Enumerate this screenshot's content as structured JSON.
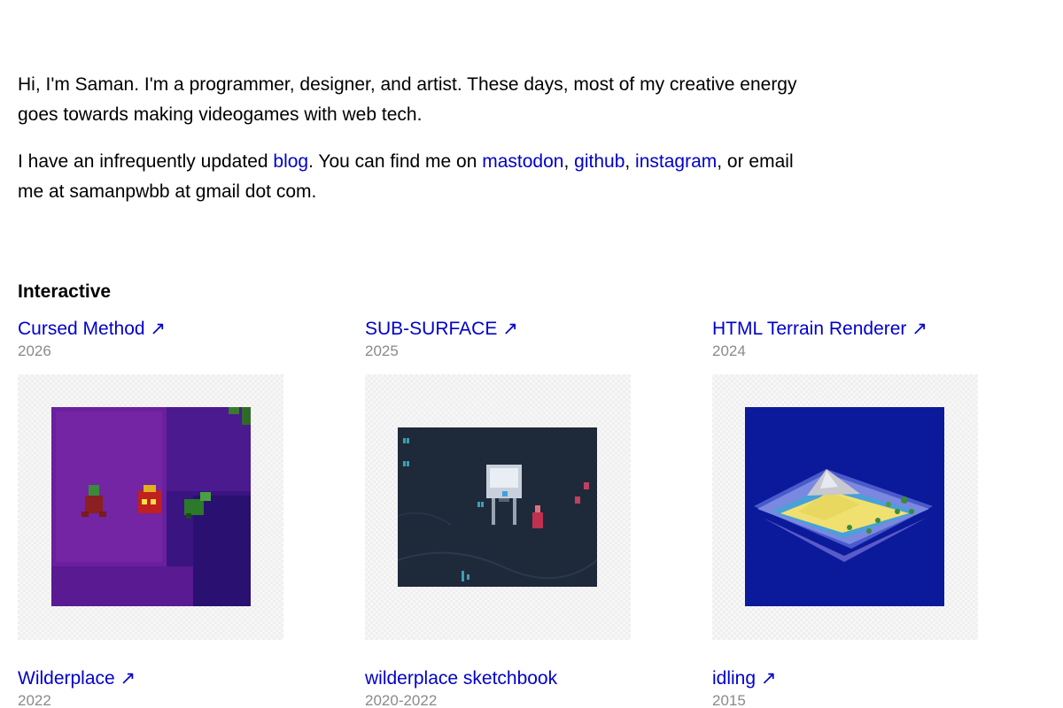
{
  "intro": {
    "p1": "Hi, I'm Saman. I'm a programmer, designer, and artist. These days, most of my creative energy goes towards making videogames with web tech.",
    "p2_before": "I have an infrequently updated ",
    "blog_link": "blog",
    "p2_mid": ". You can find me on ",
    "mastodon_link": "mastodon",
    "sep1": ", ",
    "github_link": "github",
    "sep2": ", ",
    "instagram_link": "instagram",
    "p2_after": ", or email me at samanpwbb at gmail dot com."
  },
  "section": {
    "title": "Interactive"
  },
  "projects": [
    {
      "title": "Cursed Method ↗",
      "year": "2026"
    },
    {
      "title": "SUB-SURFACE ↗",
      "year": "2025"
    },
    {
      "title": "HTML Terrain Renderer ↗",
      "year": "2024"
    },
    {
      "title": "Wilderplace ↗",
      "year": "2022"
    },
    {
      "title": "wilderplace sketchbook",
      "year": "2020-2022"
    },
    {
      "title": "idling ↗",
      "year": "2015"
    }
  ],
  "colors": {
    "link": "#0000cc",
    "muted": "#8a8a8a",
    "cursed_bg": "#5a1a9a",
    "subsurface_bg": "#1e2b3a",
    "terrain_bg": "#0a1a9a"
  }
}
